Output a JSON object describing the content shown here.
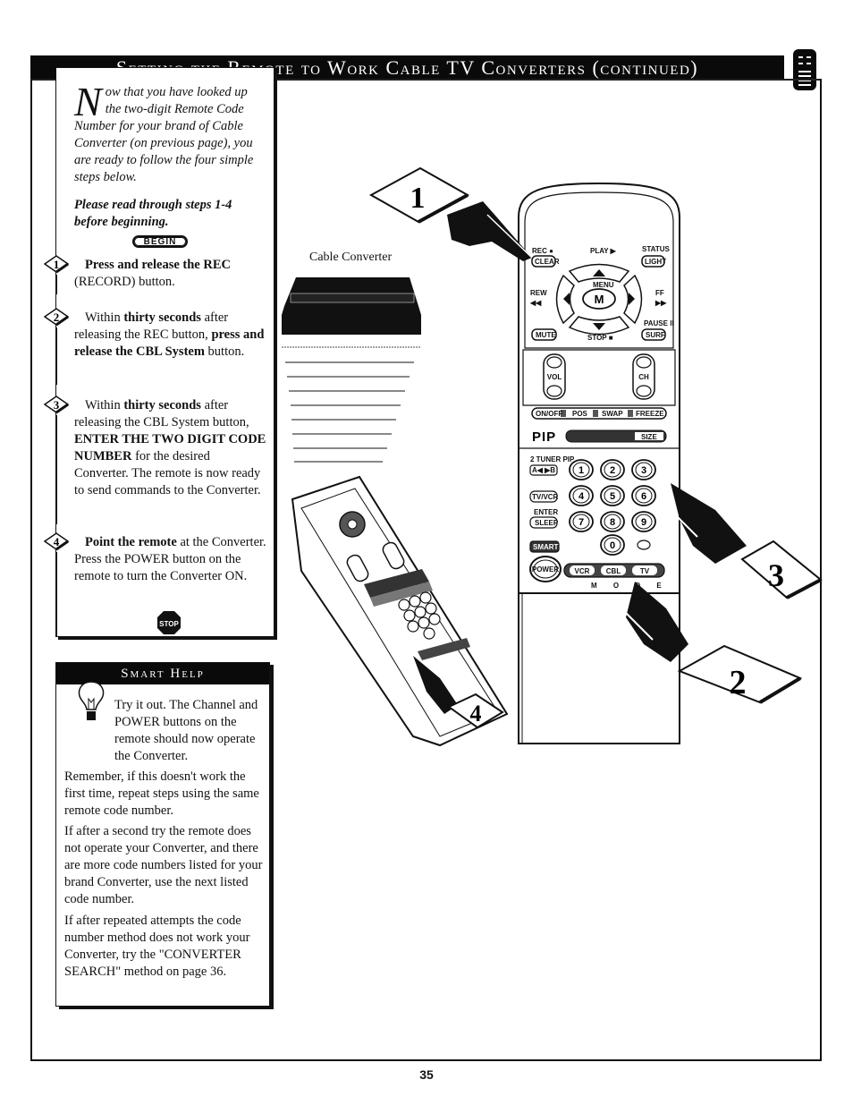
{
  "header": {
    "title": "Setting the Remote to Work Cable TV Converters (continued)",
    "icon": "remote-control-icon"
  },
  "steps_panel": {
    "intro_dropcap": "N",
    "intro": "ow that you have looked up the two-digit Remote Code Number for your brand of Cable Converter (on previous page), you are ready to follow the four simple steps below.",
    "intro_bold": "Please read through steps 1-4 before beginning.",
    "begin_label": "BEGIN",
    "steps": [
      {
        "number": "1",
        "parts": [
          {
            "text": "Press and release the REC",
            "bold": true
          },
          {
            "text": " (RECORD) button.",
            "bold": false
          }
        ]
      },
      {
        "number": "2",
        "parts": [
          {
            "text": "Within ",
            "bold": false
          },
          {
            "text": "thirty seconds",
            "bold": true
          },
          {
            "text": " after releasing the REC button, ",
            "bold": false
          },
          {
            "text": "press and release the CBL System",
            "bold": true
          },
          {
            "text": " button.",
            "bold": false
          }
        ]
      },
      {
        "number": "3",
        "parts": [
          {
            "text": "Within ",
            "bold": false
          },
          {
            "text": "thirty seconds",
            "bold": true
          },
          {
            "text": " after releasing the CBL System button, ",
            "bold": false
          },
          {
            "text": "ENTER THE TWO DIGIT CODE NUMBER",
            "bold": true
          },
          {
            "text": " for the desired Converter. The remote is now ready to send commands to the Converter.",
            "bold": false
          }
        ]
      },
      {
        "number": "4",
        "parts": [
          {
            "text": "Point the remote",
            "bold": true
          },
          {
            "text": " at the Converter. Press the POWER button on the remote to turn the Converter ON.",
            "bold": false
          }
        ]
      }
    ],
    "stop_label": "STOP"
  },
  "smart_help": {
    "title": "Smart Help",
    "paragraphs": [
      "Try it out. The Channel and POWER buttons on the remote should now operate the Converter.",
      "Remember, if this doesn't work the first time, repeat steps using the same remote code number.",
      "If after a second try the remote does not operate your Converter, and there are more code numbers listed for your brand Converter, use the next listed code number.",
      "If after repeated attempts the code number method does not work your Converter, try the \"CONVERTER SEARCH\" method on page 36."
    ]
  },
  "illustration": {
    "converter_label": "Cable Converter",
    "callouts": [
      "1",
      "2",
      "3",
      "4"
    ],
    "remote_buttons": {
      "rec": "REC ●",
      "clear": "CLEAR",
      "play": "PLAY ▶",
      "status": "STATUS",
      "light": "LIGHT",
      "rew": "REW",
      "rew_sym": "◀◀",
      "ff": "FF",
      "ff_sym": "▶▶",
      "menu": "MENU",
      "m": "M",
      "pause": "PAUSE ll",
      "mute": "MUTE",
      "stop": "STOP ■",
      "surf": "SURF",
      "vol": "VOL",
      "ch": "CH",
      "pip_row": [
        "ON/OFF",
        "POS",
        "SWAP",
        "FREEZE"
      ],
      "pip": "PIP",
      "size": "SIZE",
      "tuner_pip": "2 TUNER PIP",
      "ab": "A◀ ▶B",
      "tv_vcr": "TV/VCR",
      "enter": "ENTER",
      "sleep": "SLEEP",
      "smart": "SMART",
      "power": "POWER",
      "modes": [
        "VCR",
        "CBL",
        "TV"
      ],
      "mode_label": "M O D E",
      "digits": [
        "1",
        "2",
        "3",
        "4",
        "5",
        "6",
        "7",
        "8",
        "9",
        "0"
      ]
    }
  },
  "footer": {
    "page_number": "35"
  }
}
